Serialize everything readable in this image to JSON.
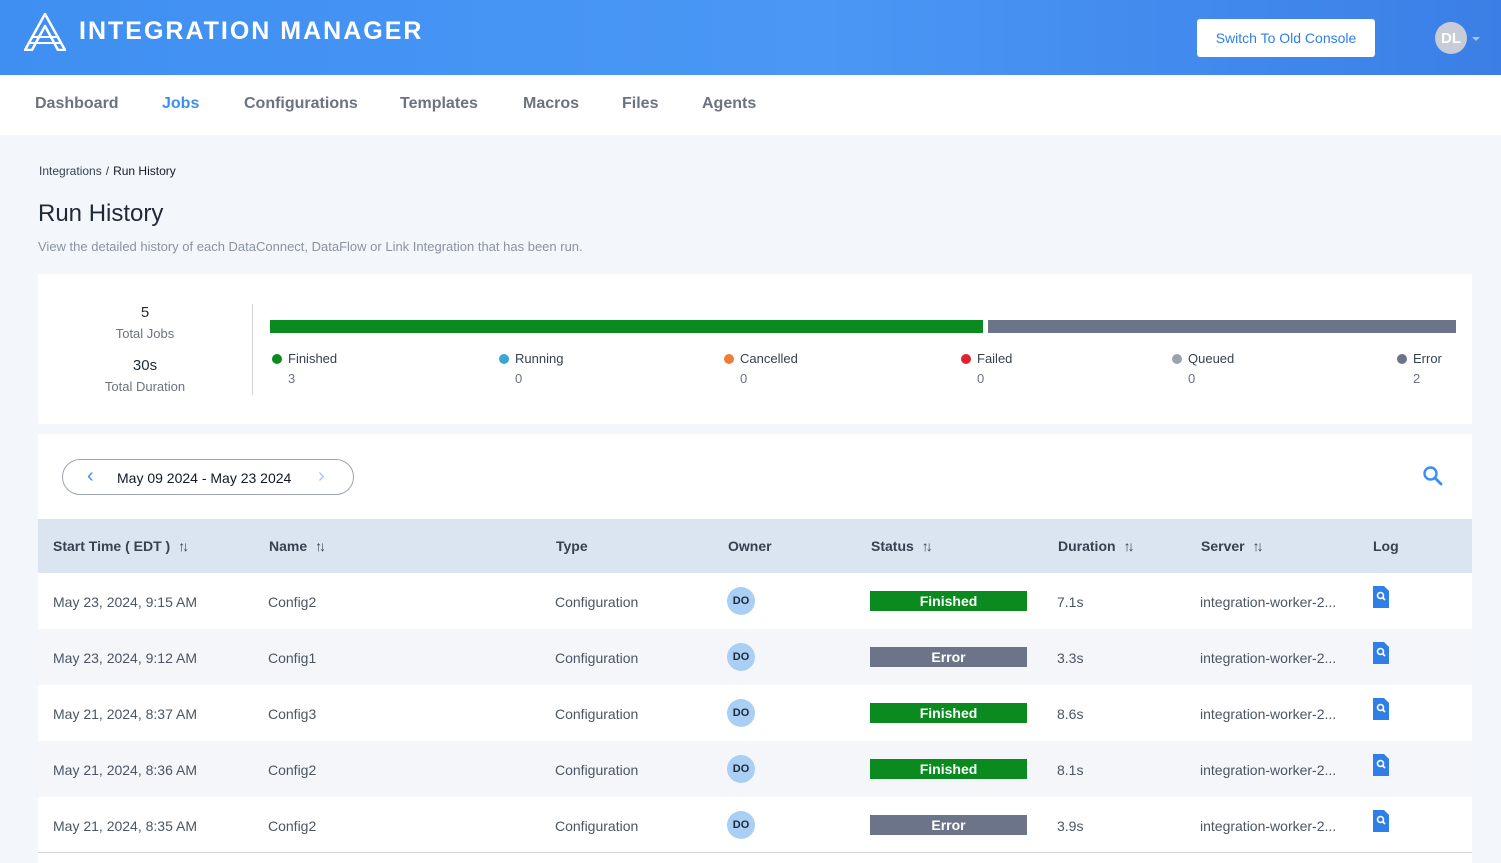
{
  "header": {
    "app_title": "INTEGRATION MANAGER",
    "old_console_label": "Switch To Old Console",
    "user_initials": "DL"
  },
  "nav": {
    "items": [
      "Dashboard",
      "Jobs",
      "Configurations",
      "Templates",
      "Macros",
      "Files",
      "Agents"
    ],
    "active": "Jobs"
  },
  "breadcrumb": {
    "parent": "Integrations",
    "separator": "/",
    "current": "Run History"
  },
  "page": {
    "title": "Run History",
    "subtitle": "View the detailed history of each DataConnect, DataFlow or Link Integration that has been run."
  },
  "summary": {
    "total_jobs": "5",
    "total_jobs_label": "Total Jobs",
    "total_duration": "30s",
    "total_duration_label": "Total Duration",
    "legend": [
      {
        "label": "Finished",
        "count": "3",
        "color": "#0a8a1f"
      },
      {
        "label": "Running",
        "count": "0",
        "color": "#3aa6d8"
      },
      {
        "label": "Cancelled",
        "count": "0",
        "color": "#f07d34"
      },
      {
        "label": "Failed",
        "count": "0",
        "color": "#e0232b"
      },
      {
        "label": "Queued",
        "count": "0",
        "color": "#9aa2ad"
      },
      {
        "label": "Error",
        "count": "2",
        "color": "#6b7489"
      }
    ]
  },
  "filters": {
    "date_range": "May 09 2024 - May 23 2024"
  },
  "table": {
    "columns": [
      "Start Time ( EDT )",
      "Name",
      "Type",
      "Owner",
      "Status",
      "Duration",
      "Server",
      "Log"
    ],
    "rows": [
      {
        "start": "May 23, 2024, 9:15 AM",
        "name": "Config2",
        "type": "Configuration",
        "owner": "DO",
        "status": "Finished",
        "duration": "7.1s",
        "server": "integration-worker-2..."
      },
      {
        "start": "May 23, 2024, 9:12 AM",
        "name": "Config1",
        "type": "Configuration",
        "owner": "DO",
        "status": "Error",
        "duration": "3.3s",
        "server": "integration-worker-2..."
      },
      {
        "start": "May 21, 2024, 8:37 AM",
        "name": "Config3",
        "type": "Configuration",
        "owner": "DO",
        "status": "Finished",
        "duration": "8.6s",
        "server": "integration-worker-2..."
      },
      {
        "start": "May 21, 2024, 8:36 AM",
        "name": "Config2",
        "type": "Configuration",
        "owner": "DO",
        "status": "Finished",
        "duration": "8.1s",
        "server": "integration-worker-2..."
      },
      {
        "start": "May 21, 2024, 8:35 AM",
        "name": "Config2",
        "type": "Configuration",
        "owner": "DO",
        "status": "Error",
        "duration": "3.9s",
        "server": "integration-worker-2..."
      }
    ]
  },
  "colors": {
    "accent": "#3b8ff0",
    "finished": "#0a8a1f",
    "error": "#6b7489"
  },
  "icons": {
    "search": "search-icon",
    "log": "log-file-icon",
    "sort": "sort-icon"
  }
}
